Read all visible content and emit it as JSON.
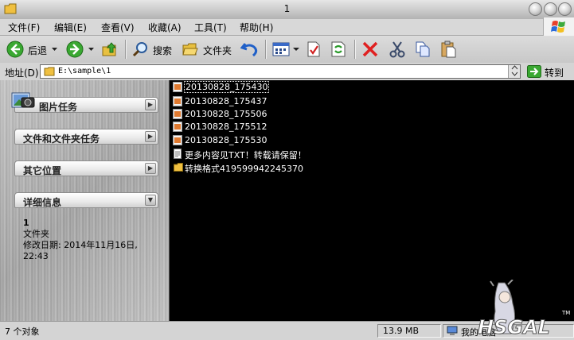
{
  "window": {
    "title": "1"
  },
  "menu": [
    "文件(F)",
    "编辑(E)",
    "查看(V)",
    "收藏(A)",
    "工具(T)",
    "帮助(H)"
  ],
  "toolbar": {
    "back_label": "后退",
    "search_label": "搜索",
    "folders_label": "文件夹"
  },
  "address": {
    "label": "地址(D)",
    "path": "E:\\sample\\1",
    "go_label": "转到"
  },
  "tasks": [
    {
      "label": "图片任务"
    },
    {
      "label": "文件和文件夹任务"
    },
    {
      "label": "其它位置"
    },
    {
      "label": "详细信息"
    }
  ],
  "details": {
    "name": "1",
    "type": "文件夹",
    "modified_label": "修改日期: 2014年11月16日,",
    "modified_time": "22:43"
  },
  "files": [
    {
      "name": "20130828_175430",
      "kind": "image"
    },
    {
      "name": "20130828_175437",
      "kind": "image"
    },
    {
      "name": "20130828_175506",
      "kind": "image"
    },
    {
      "name": "20130828_175512",
      "kind": "image"
    },
    {
      "name": "20130828_175530",
      "kind": "image"
    },
    {
      "name": "更多内容见TXT！转载请保留！",
      "kind": "text"
    },
    {
      "name": "转换格式419599942245370",
      "kind": "folder"
    }
  ],
  "status": {
    "count": "7 个对象",
    "size": "13.9 MB",
    "location": "我的电脑"
  },
  "watermark": {
    "text": "HSGAL"
  },
  "colors": {
    "filelist_bg": "#000000",
    "text_light": "#ffffff",
    "accent_green": "#3aa832"
  }
}
